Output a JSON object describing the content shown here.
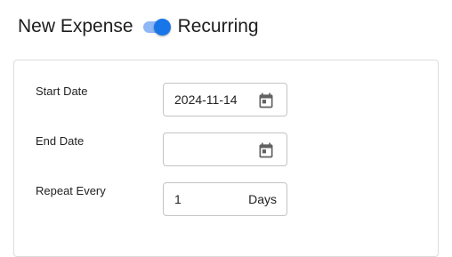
{
  "header": {
    "title": "New Expense",
    "toggle_label": "Recurring",
    "recurring_on": true
  },
  "form": {
    "start_date": {
      "label": "Start Date",
      "value": "2024-11-14",
      "icon": "calendar-icon"
    },
    "end_date": {
      "label": "End Date",
      "value": "",
      "icon": "calendar-icon"
    },
    "repeat_every": {
      "label": "Repeat Every",
      "value": "1",
      "unit": "Days"
    }
  },
  "colors": {
    "accent": "#1976e8",
    "accent_track": "#8fb7f5",
    "border": "#c4c4c4",
    "icon": "#616161"
  }
}
